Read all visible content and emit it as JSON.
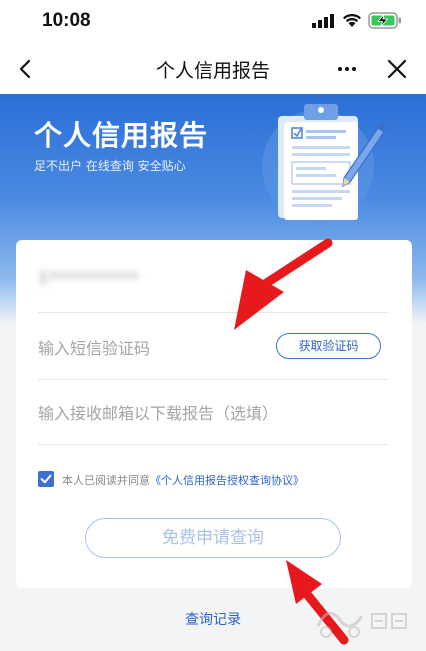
{
  "status_bar": {
    "time": "10:08"
  },
  "nav": {
    "title": "个人信用报告"
  },
  "hero": {
    "title": "个人信用报告",
    "subtitle": "足不出户 在线查询 安全贴心"
  },
  "form": {
    "phone_value": "1**********",
    "sms_placeholder": "输入短信验证码",
    "get_code_label": "获取验证码",
    "email_placeholder": "输入接收邮箱以下载报告（选填）",
    "agree_prefix": "本人已阅读并同意",
    "agree_link": "《个人信用报告授权查询协议》",
    "agree_checked": true,
    "submit_label": "免费申请查询"
  },
  "footer": {
    "records_link": "查询记录"
  },
  "colors": {
    "primary": "#2b6fd6",
    "link": "#2d63c8",
    "annotation_arrow": "#e8191c"
  },
  "icons": [
    "back-arrow-icon",
    "more-icon",
    "close-icon",
    "signal-icon",
    "wifi-icon",
    "battery-charging-icon",
    "checkbox-checked-icon"
  ]
}
